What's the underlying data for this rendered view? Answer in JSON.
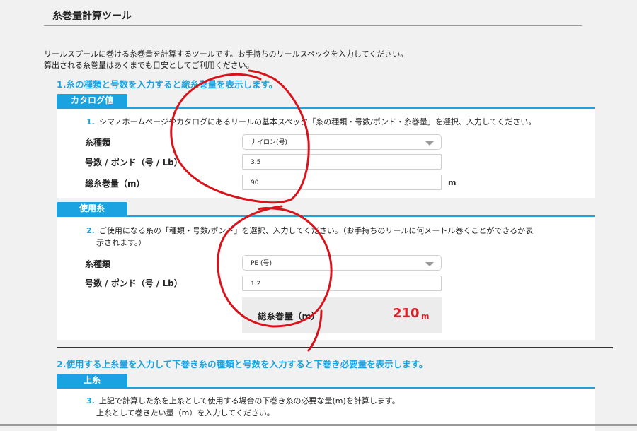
{
  "title": "糸巻量計算ツール",
  "intro": [
    "リールスプールに巻ける糸巻量を計算するツールです。お手持ちのリールスペックを入力してください。",
    "算出される糸巻量はあくまでも目安としてご利用ください。"
  ],
  "section1": {
    "heading": "1.糸の種類と号数を入力すると総糸巻量を表示します。"
  },
  "catalog": {
    "tab": "カタログ値",
    "step_num": "1.",
    "step_text": "シマノホームページやカタログにあるリールの基本スペック「糸の種類・号数/ポンド・糸巻量」を選択、入力してください。",
    "line_type_label": "糸種類",
    "line_type_value": "ナイロン(号)",
    "size_label": "号数 / ポンド（号 / Lb）",
    "size_value": "3.5",
    "capacity_label": "総糸巻量（m）",
    "capacity_value": "90",
    "capacity_unit": "m"
  },
  "usage": {
    "tab": "使用糸",
    "step_num": "2.",
    "step_text_line1": "ご使用になる糸の「種類・号数/ポンド」を選択、入力してください。（お手持ちのリールに何メートル巻くことができるか表",
    "step_text_line2": "示されます。）",
    "line_type_label": "糸種類",
    "line_type_value": "PE (号)",
    "size_label": "号数 / ポンド（号 / Lb）",
    "size_value": "1.2",
    "result_label": "総糸巻量（m）",
    "result_value": "210",
    "result_unit": "m"
  },
  "section2": {
    "heading": "2.使用する上糸量を入力して下巻き糸の種類と号数を入力すると下巻き必要量を表示します。"
  },
  "upper": {
    "tab": "上糸",
    "step_num": "3.",
    "step_text_line1": "上記で計算した糸を上糸として使用する場合の下巻き糸の必要な量(m)を計算します。",
    "step_text_line2": "上糸として巻きたい量（m）を入力してください。"
  },
  "colors": {
    "accent": "#1aa3e0",
    "result": "#d61f26",
    "annotation": "#d8131b"
  }
}
